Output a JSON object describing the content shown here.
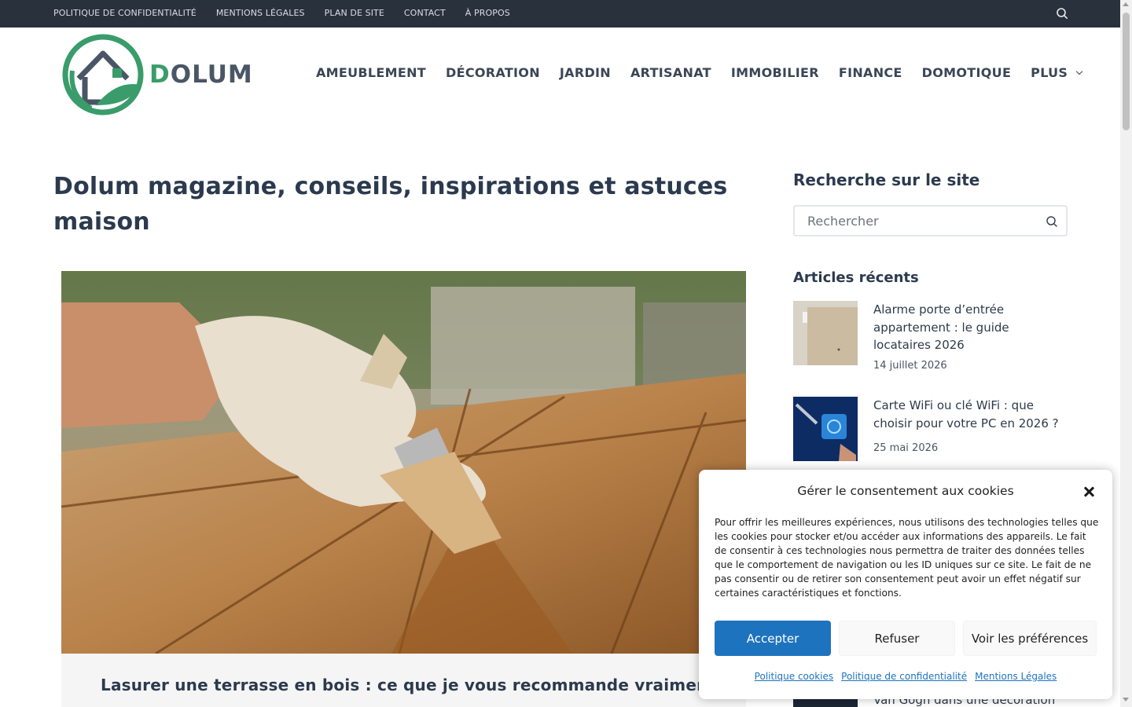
{
  "topbar": {
    "links": [
      "POLITIQUE DE CONFIDENTIALITÉ",
      "MENTIONS LÉGALES",
      "PLAN DE SITE",
      "CONTACT",
      "À PROPOS"
    ],
    "search_icon": "search-icon"
  },
  "header": {
    "logo_text_d": "D",
    "logo_text_rest": "OLUM",
    "nav": [
      "AMEUBLEMENT",
      "DÉCORATION",
      "JARDIN",
      "ARTISANAT",
      "IMMOBILIER",
      "FINANCE",
      "DOMOTIQUE",
      "PLUS"
    ],
    "colors": {
      "accent_green": "#3a9c6a",
      "nav_text": "#3a4656",
      "topbar_bg": "#29313d"
    }
  },
  "main": {
    "page_title": "Dolum magazine, conseils, inspirations et astuces maison",
    "featured_post_title": "Lasurer une terrasse en bois : ce que je vous recommande vraiment"
  },
  "sidebar": {
    "search_title": "Recherche sur le site",
    "search_placeholder": "Rechercher",
    "recent_title": "Articles récents",
    "recent": [
      {
        "title": "Alarme porte d’entrée appartement : le guide locataires 2026",
        "date": "14 juillet 2026"
      },
      {
        "title": "Carte WiFi ou clé WiFi : que choisir pour votre PC en 2026 ?",
        "date": "25 mai 2026"
      }
    ],
    "partial_title": "Van Gogh dans une décoration"
  },
  "cookie": {
    "title": "Gérer le consentement aux cookies",
    "text": "Pour offrir les meilleures expériences, nous utilisons des technologies telles que les cookies pour stocker et/ou accéder aux informations des appareils. Le fait de consentir à ces technologies nous permettra de traiter des données telles que le comportement de navigation ou les ID uniques sur ce site. Le fait de ne pas consentir ou de retirer son consentement peut avoir un effet négatif sur certaines caractéristiques et fonctions.",
    "accept": "Accepter",
    "refuse": "Refuser",
    "prefs": "Voir les préférences",
    "links": [
      "Politique cookies",
      "Politique de confidentialité",
      "Mentions Légales"
    ],
    "accent": "#1e73be"
  }
}
